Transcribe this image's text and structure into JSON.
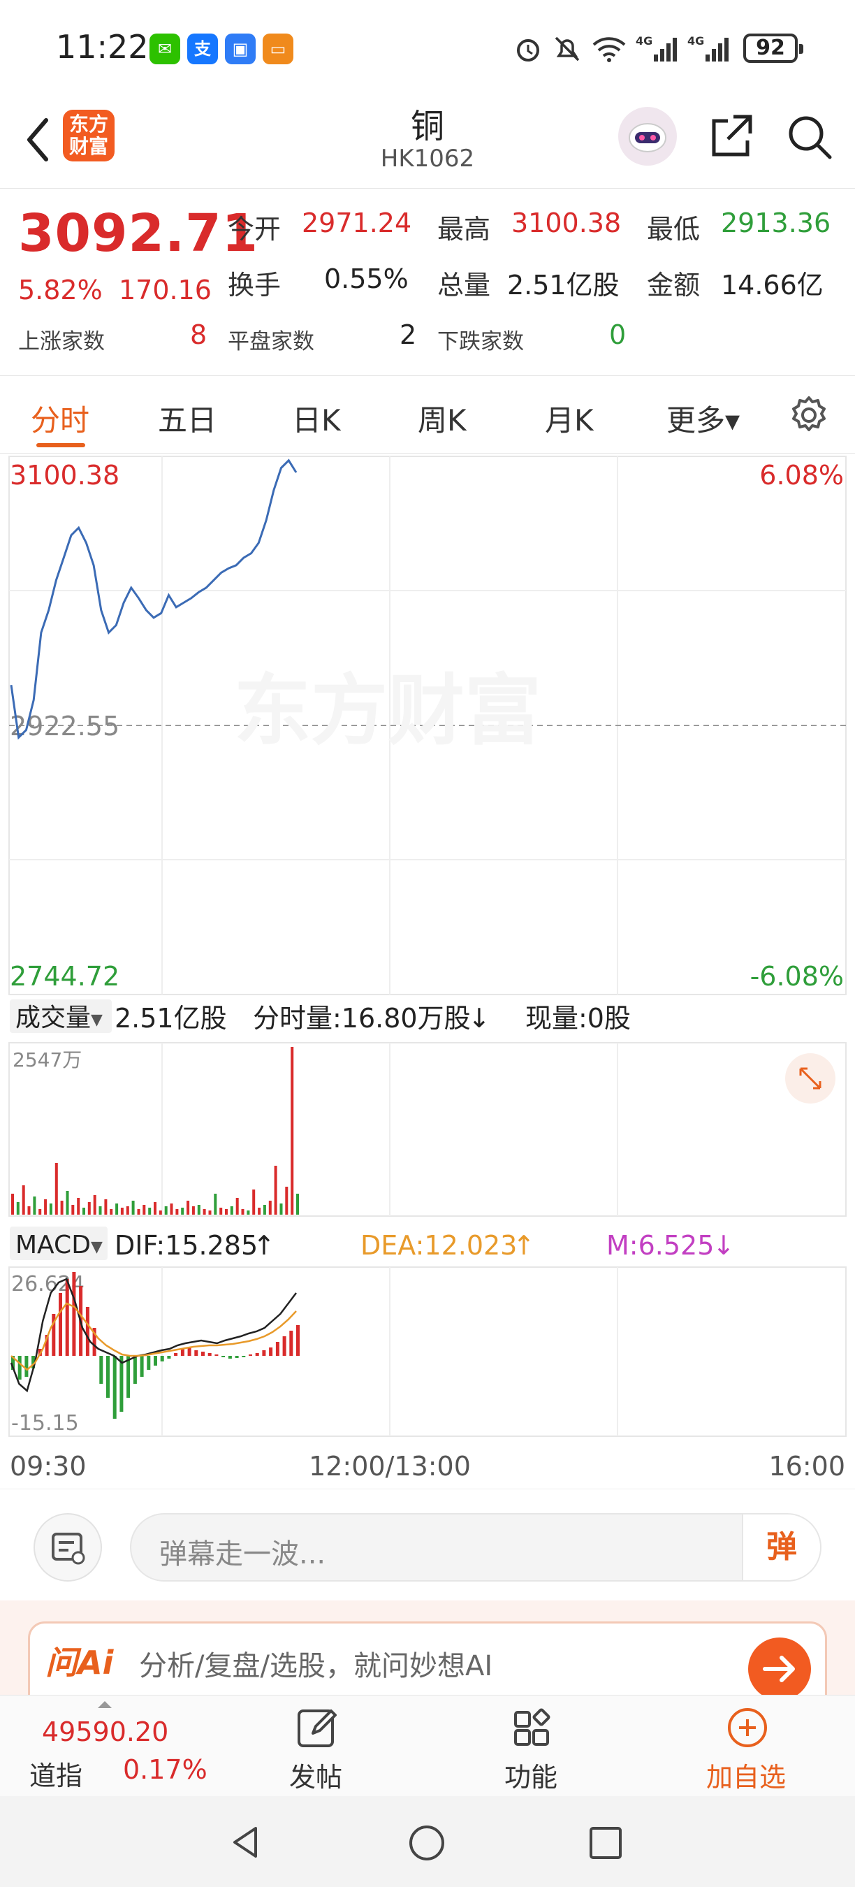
{
  "status_bar": {
    "time": "11:22",
    "apps": [
      "wechat-icon",
      "alipay-icon",
      "app-market-icon",
      "wallet-icon"
    ],
    "indicators": [
      "alarm-icon",
      "mute-icon",
      "wifi-icon",
      "signal-4g-icon",
      "signal-4g-icon"
    ],
    "battery": "92"
  },
  "header": {
    "logo_text": "东方财富",
    "title": "铜",
    "code": "HK1062"
  },
  "quote": {
    "price": "3092.71",
    "change_pct": "5.82%",
    "change_val": "170.16",
    "open_label": "今开",
    "open": "2971.24",
    "high_label": "最高",
    "high": "3100.38",
    "low_label": "最低",
    "low": "2913.36",
    "turnover_label": "换手",
    "turnover": "0.55%",
    "volume_label": "总量",
    "volume": "2.51亿股",
    "amount_label": "金额",
    "amount": "14.66亿",
    "up_label": "上涨家数",
    "up": "8",
    "flat_label": "平盘家数",
    "flat": "2",
    "down_label": "下跌家数",
    "down": "0"
  },
  "tabs": [
    {
      "label": "分时",
      "active": true
    },
    {
      "label": "五日"
    },
    {
      "label": "日K"
    },
    {
      "label": "周K"
    },
    {
      "label": "月K"
    },
    {
      "label": "更多▾"
    }
  ],
  "chart": {
    "price_top": "3100.38",
    "pct_top": "6.08%",
    "price_mid": "2922.55",
    "price_bottom": "2744.72",
    "pct_bottom": "-6.08%",
    "watermark": "东方财富",
    "volume_selector": "成交量",
    "volume_total": "2.51亿股",
    "volume_min": "分时量:16.80万股",
    "volume_min_arrow": "↓",
    "volume_now": "现量:0股",
    "volume_max": "2547万",
    "macd_selector": "MACD",
    "dif": "DIF:15.285",
    "dif_arrow": "↑",
    "dea": "DEA:12.023",
    "dea_arrow": "↑",
    "m": "M:6.525",
    "m_arrow": "↓",
    "macd_top": "26.624",
    "macd_bottom": "-15.15",
    "time_start": "09:30",
    "time_mid": "12:00/13:00",
    "time_end": "16:00"
  },
  "chart_data": {
    "type": "line",
    "y_range": [
      2744.72,
      3100.38
    ],
    "baseline": 2922.55,
    "x": [
      "09:30",
      "12:00/13:00",
      "16:00"
    ],
    "series": [
      {
        "values": [
          2950,
          2915,
          2920,
          2940,
          2985,
          3000,
          3020,
          3035,
          3050,
          3055,
          3045,
          3030,
          3000,
          2985,
          2990,
          3005,
          3015,
          3008,
          3000,
          2995,
          2998,
          3010,
          3002,
          3005,
          3008,
          3012,
          3015,
          3020,
          3025,
          3028,
          3030,
          3035,
          3038,
          3045,
          3060,
          3080,
          3095,
          3100,
          3092
        ]
      }
    ]
  },
  "barrage": {
    "placeholder": "弹幕走一波...",
    "send_label": "弹"
  },
  "ai_bar": {
    "logo": "问Ai",
    "text": "分析/复盘/选股，就问妙想AI"
  },
  "bottom_nav": {
    "index_value": "49590.20",
    "index_name": "道指",
    "index_pct": "0.17%",
    "post_label": "发帖",
    "func_label": "功能",
    "add_label": "加自选"
  },
  "colors": {
    "up": "#d92b2b",
    "down": "#2f9e3a",
    "accent": "#e8601d",
    "line": "#3b6bb5"
  }
}
